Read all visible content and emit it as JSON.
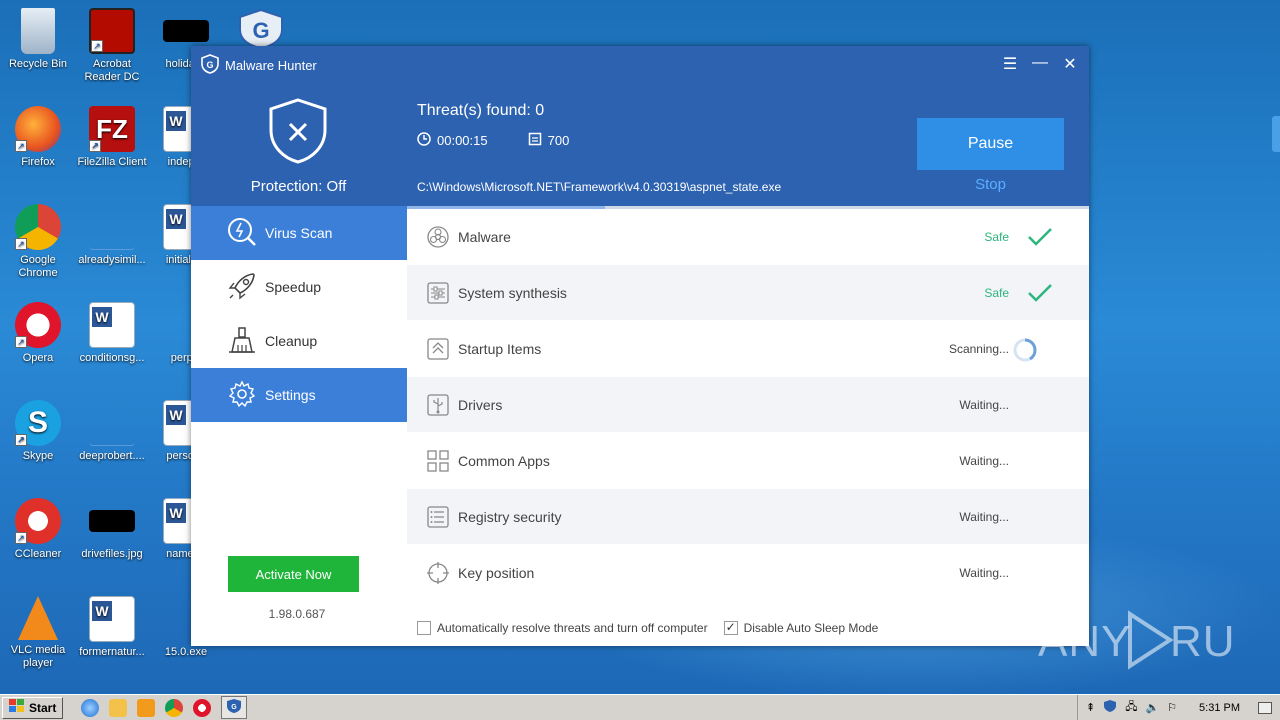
{
  "desktop": {
    "icons": [
      {
        "label": "Recycle Bin",
        "icon": "recycle-bin-icon"
      },
      {
        "label": "Acrobat Reader DC",
        "icon": "acrobat-icon"
      },
      {
        "label": "holidayb",
        "icon": "image-file-icon"
      },
      {
        "label": "Firefox",
        "icon": "firefox-icon"
      },
      {
        "label": "FileZilla Client",
        "icon": "filezilla-icon"
      },
      {
        "label": "indeper",
        "icon": "word-doc-icon"
      },
      {
        "label": "Google Chrome",
        "icon": "chrome-icon"
      },
      {
        "label": "alreadysimil...",
        "icon": "file-icon"
      },
      {
        "label": "initialmo",
        "icon": "word-doc-icon"
      },
      {
        "label": "Opera",
        "icon": "opera-icon"
      },
      {
        "label": "conditionsg...",
        "icon": "word-doc-icon"
      },
      {
        "label": "perpal",
        "icon": "file-icon"
      },
      {
        "label": "Skype",
        "icon": "skype-icon"
      },
      {
        "label": "deeprobert....",
        "icon": "file-icon"
      },
      {
        "label": "persons",
        "icon": "word-doc-icon"
      },
      {
        "label": "CCleaner",
        "icon": "ccleaner-icon"
      },
      {
        "label": "drivefiles.jpg",
        "icon": "image-file-icon"
      },
      {
        "label": "namene",
        "icon": "word-doc-icon"
      },
      {
        "label": "VLC media player",
        "icon": "vlc-icon"
      },
      {
        "label": "formernatur...",
        "icon": "word-doc-icon"
      },
      {
        "label": "15.0.exe",
        "icon": "exe-icon"
      }
    ]
  },
  "app": {
    "title": "Malware Hunter",
    "protection_status": "Protection: Off",
    "threats_label": "Threat(s) found:",
    "threats_count": "0",
    "elapsed": "00:00:15",
    "files_scanned": "700",
    "current_path": "C:\\Windows\\Microsoft.NET\\Framework\\v4.0.30319\\aspnet_state.exe",
    "pause_label": "Pause",
    "stop_label": "Stop",
    "scan_progress": 0.29,
    "colors": {
      "header": "#2d62b0",
      "accent": "#3b7fd9",
      "safe": "#2cb67d",
      "activate": "#1fb53a"
    },
    "nav": [
      {
        "label": "Virus Scan",
        "icon": "virus-scan-icon",
        "active": true
      },
      {
        "label": "Speedup",
        "icon": "rocket-icon",
        "active": false
      },
      {
        "label": "Cleanup",
        "icon": "broom-icon",
        "active": false
      },
      {
        "label": "Settings",
        "icon": "gear-icon",
        "active": true
      }
    ],
    "activate_label": "Activate Now",
    "version": "1.98.0.687",
    "scan_items": [
      {
        "label": "Malware",
        "status": "Safe",
        "state": "safe",
        "icon": "biohazard-icon"
      },
      {
        "label": "System synthesis",
        "status": "Safe",
        "state": "safe",
        "icon": "sliders-icon"
      },
      {
        "label": "Startup Items",
        "status": "Scanning...",
        "state": "scanning",
        "icon": "startup-icon"
      },
      {
        "label": "Drivers",
        "status": "Waiting...",
        "state": "waiting",
        "icon": "usb-icon"
      },
      {
        "label": "Common Apps",
        "status": "Waiting...",
        "state": "waiting",
        "icon": "grid-icon"
      },
      {
        "label": "Registry security",
        "status": "Waiting...",
        "state": "waiting",
        "icon": "list-icon"
      },
      {
        "label": "Key position",
        "status": "Waiting...",
        "state": "waiting",
        "icon": "crosshair-icon"
      }
    ],
    "options": {
      "auto_resolve": {
        "label": "Automatically resolve threats and turn off computer",
        "checked": false
      },
      "disable_sleep": {
        "label": "Disable Auto Sleep Mode",
        "checked": true
      }
    }
  },
  "watermark": "ANY RUN",
  "taskbar": {
    "start_label": "Start",
    "clock": "5:31 PM"
  }
}
